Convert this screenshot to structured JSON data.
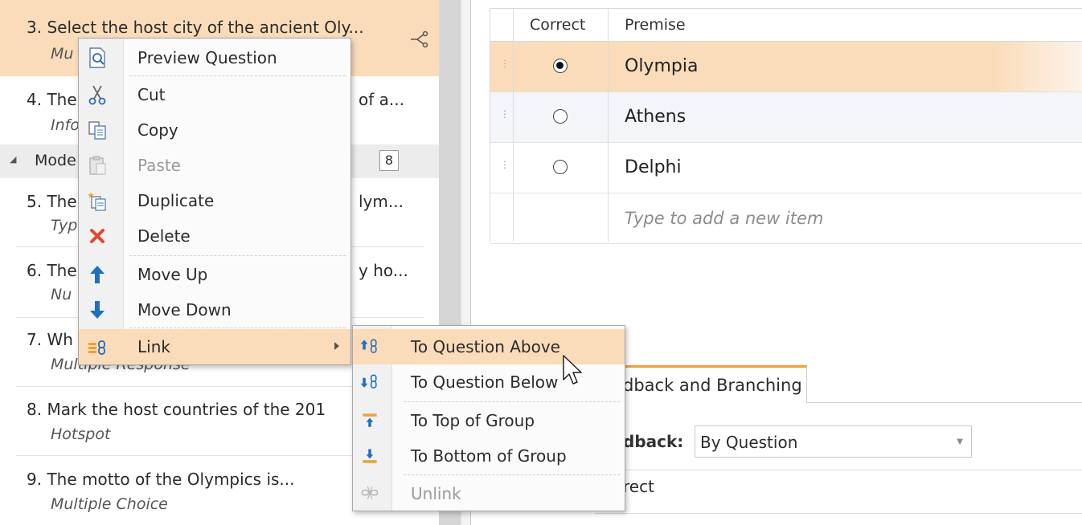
{
  "questions": [
    {
      "title": "3. Select the host city of the ancient Oly...",
      "type": "Mu"
    },
    {
      "title": "4. The",
      "title_tail": "of a...",
      "type": "Info"
    },
    {
      "title": "5. The",
      "title_tail": "lym...",
      "type": "Typ"
    },
    {
      "title": "6. The",
      "title_tail": "y ho...",
      "type": "Nu"
    },
    {
      "title": "7. Wh",
      "type": "Multiple Response"
    },
    {
      "title": "8. Mark the host countries of the 201",
      "type": "Hotspot"
    },
    {
      "title": "9. The motto of the Olympics is...",
      "type": "Multiple Choice"
    }
  ],
  "group": {
    "label": "Mode",
    "count": "8"
  },
  "grid": {
    "headers": {
      "correct": "Correct",
      "premise": "Premise"
    },
    "rows": [
      {
        "premise": "Olympia",
        "selected": true
      },
      {
        "premise": "Athens",
        "selected": false
      },
      {
        "premise": "Delphi",
        "selected": false
      }
    ],
    "new_item_placeholder": "Type to add a new item"
  },
  "feedback": {
    "tab_label": "dback and Branching",
    "field_label": "dback:",
    "select_value": "By Question",
    "row_label": "rect"
  },
  "context_menu": {
    "items": [
      {
        "label": "Preview Question",
        "icon": "preview-icon"
      },
      {
        "label": "Cut",
        "icon": "scissors-icon"
      },
      {
        "label": "Copy",
        "icon": "copy-icon"
      },
      {
        "label": "Paste",
        "icon": "paste-icon",
        "disabled": true
      },
      {
        "label": "Duplicate",
        "icon": "duplicate-icon"
      },
      {
        "label": "Delete",
        "icon": "delete-icon"
      },
      {
        "label": "Move Up",
        "icon": "arrow-up-icon"
      },
      {
        "label": "Move Down",
        "icon": "arrow-down-icon"
      },
      {
        "label": "Link",
        "icon": "link-icon",
        "highlighted": true
      }
    ]
  },
  "submenu": {
    "items": [
      {
        "label": "To Question Above",
        "icon": "link-above-icon",
        "highlighted": true
      },
      {
        "label": "To Question Below",
        "icon": "link-below-icon"
      },
      {
        "label": "To Top of Group",
        "icon": "top-of-group-icon"
      },
      {
        "label": "To Bottom of Group",
        "icon": "bottom-of-group-icon"
      },
      {
        "label": "Unlink",
        "icon": "unlink-icon",
        "disabled": true
      }
    ]
  },
  "colors": {
    "selection": "#fadcba",
    "accent": "#f0a030",
    "arrow_blue": "#1f6fc0",
    "delete_red": "#e04b2f"
  }
}
